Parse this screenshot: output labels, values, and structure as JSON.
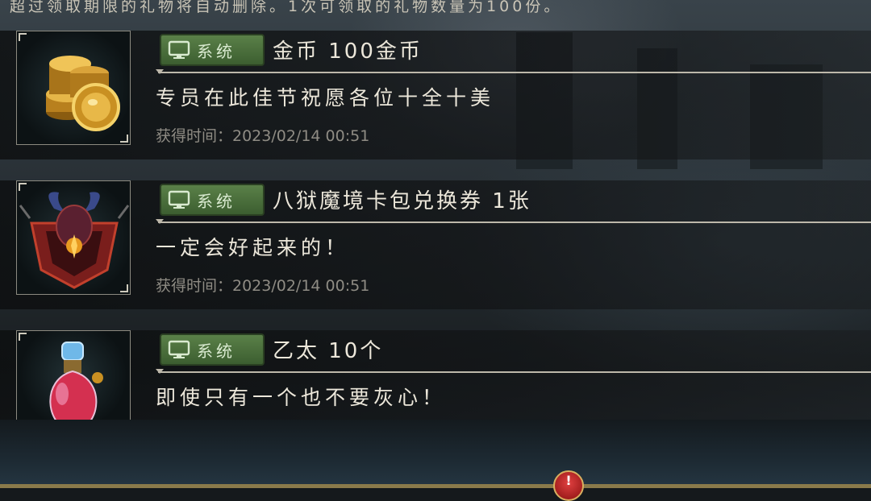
{
  "notice": "超过领取期限的礼物将自动删除。1次可领取的礼物数量为100份。",
  "colors": {
    "tag_green": "#4a7040",
    "title_text": "#ece7da",
    "time_text": "#8f8c84",
    "alert_red": "#c82020"
  },
  "mails": [
    {
      "item_icon": "gold-coins-icon",
      "tag": "系统",
      "title": "金币 100金币",
      "message": "专员在此佳节祝愿各位十全十美",
      "time": "获得时间：2023/02/14 00:51"
    },
    {
      "item_icon": "demon-card-pack-icon",
      "tag": "系统",
      "title": "八狱魔境卡包兑换券 1张",
      "message": "一定会好起来的！",
      "time": "获得时间：2023/02/14 00:51"
    },
    {
      "item_icon": "ether-potion-icon",
      "tag": "系统",
      "title": "乙太 10个",
      "message": "即使只有一个也不要灰心！",
      "time": ""
    }
  ],
  "alert_badge": "!"
}
